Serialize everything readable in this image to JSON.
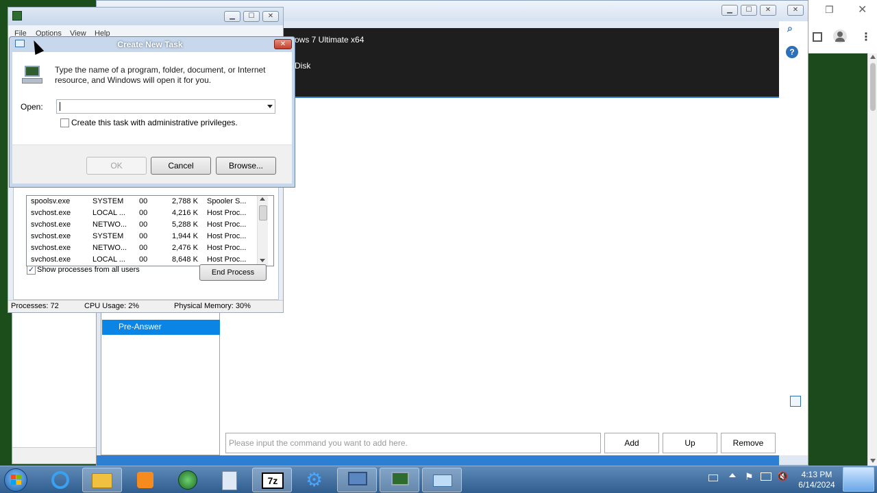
{
  "background_app": {
    "title": "",
    "dark_header_line1": "ows 7 Ultimate x64",
    "dark_header_line2": "Disk",
    "selected_item": "Pre-Answer",
    "command_placeholder": "Please input the command you want to add here.",
    "buttons": {
      "add": "Add",
      "up": "Up",
      "remove": "Remove"
    }
  },
  "task_manager": {
    "menu": [
      "File",
      "Options",
      "View",
      "Help"
    ],
    "processes": [
      {
        "name": "spoolsv.exe",
        "user": "SYSTEM",
        "cpu": "00",
        "memory": "2,788 K",
        "desc": "Spooler S..."
      },
      {
        "name": "svchost.exe",
        "user": "LOCAL ...",
        "cpu": "00",
        "memory": "4,216 K",
        "desc": "Host Proc..."
      },
      {
        "name": "svchost.exe",
        "user": "NETWO...",
        "cpu": "00",
        "memory": "5,288 K",
        "desc": "Host Proc..."
      },
      {
        "name": "svchost.exe",
        "user": "SYSTEM",
        "cpu": "00",
        "memory": "1,944 K",
        "desc": "Host Proc..."
      },
      {
        "name": "svchost.exe",
        "user": "NETWO...",
        "cpu": "00",
        "memory": "2,476 K",
        "desc": "Host Proc..."
      },
      {
        "name": "svchost.exe",
        "user": "LOCAL ...",
        "cpu": "00",
        "memory": "8,648 K",
        "desc": "Host Proc..."
      }
    ],
    "show_all_users_label": "Show processes from all users",
    "show_all_users_checked": true,
    "end_process_label": "End Process",
    "status": {
      "processes": "Processes: 72",
      "cpu": "CPU Usage: 2%",
      "memory": "Physical Memory: 30%"
    }
  },
  "dialog": {
    "title": "Create New Task",
    "description": "Type the name of a program, folder, document, or Internet resource, and Windows will open it for you.",
    "open_label": "Open:",
    "open_value": "",
    "admin_label": "Create this task with administrative privileges.",
    "admin_checked": false,
    "ok_label": "OK",
    "cancel_label": "Cancel",
    "browse_label": "Browse..."
  },
  "taskbar": {
    "time": "4:13 PM",
    "date": "6/14/2024",
    "apps": [
      "internet-explorer",
      "file-explorer",
      "media-player",
      "network-globe",
      "notepad-files",
      "7zip",
      "gear-settings",
      "computer-network",
      "task-manager",
      "run-dialog"
    ]
  },
  "colors": {
    "accent": "#2d7fd4",
    "selection": "#0a84e5",
    "taskbar": "#3d6b9c"
  }
}
